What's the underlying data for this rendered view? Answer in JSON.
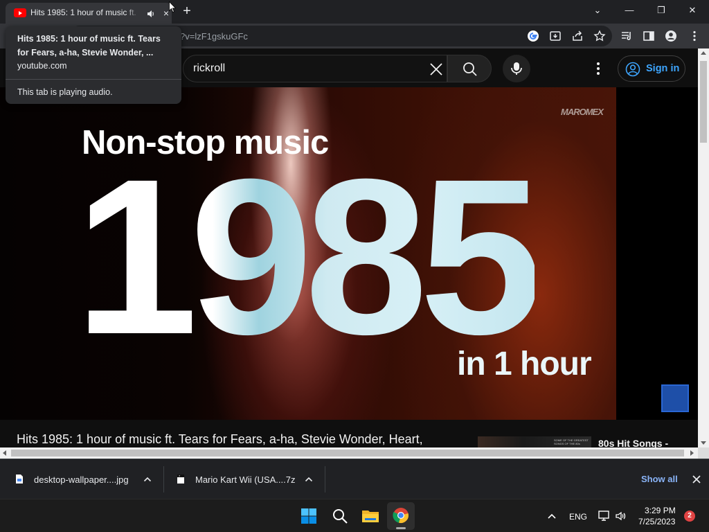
{
  "browser": {
    "tab": {
      "title": "Hits 1985: 1 hour of music ft.",
      "close_glyph": "×"
    },
    "new_tab_glyph": "+",
    "window_controls": {
      "dropdown": "⌄",
      "minimize": "—",
      "restore": "❐",
      "close": "✕"
    },
    "url_fragment": "?v=lzF1gskuGFc",
    "tooltip": {
      "title": "Hits 1985: 1 hour of music ft. Tears for Fears, a-ha, Stevie Wonder, ...",
      "domain": "youtube.com",
      "status": "This tab is playing audio."
    }
  },
  "youtube": {
    "search": {
      "query": "rickroll"
    },
    "sign_in_label": "Sign in",
    "video": {
      "line1": "Non-stop music",
      "big_text": "1985",
      "line3": "in 1 hour",
      "watermark": "MAROMEX"
    },
    "video_title": "Hits 1985: 1 hour of music ft. Tears for Fears, a-ha, Stevie Wonder, Heart,",
    "recommendation": {
      "thumb_text": "SOME OF THE GREATEST SONGS OF THE 80s",
      "title": "80s Hit Songs -"
    },
    "accent_color": "#3ea6ff"
  },
  "downloads": {
    "items": [
      {
        "name": "desktop-wallpaper....jpg",
        "icon": "image-file-icon"
      },
      {
        "name": "Mario Kart Wii (USA....7z",
        "icon": "archive-file-icon"
      }
    ],
    "show_all_label": "Show all"
  },
  "taskbar": {
    "apps": [
      "start-icon",
      "search-icon",
      "file-explorer-icon",
      "chrome-icon"
    ],
    "language": "ENG",
    "time": "3:29 PM",
    "date": "7/25/2023",
    "notification_count": "2"
  }
}
